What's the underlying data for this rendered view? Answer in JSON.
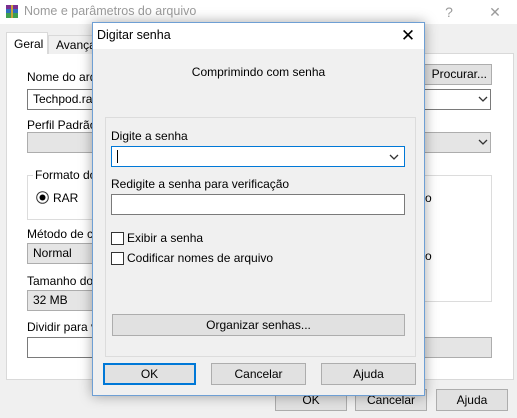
{
  "background_window": {
    "title": "Nome e parâmetros do arquivo",
    "controls": {
      "help": "?",
      "close": "✕"
    },
    "tabs": [
      "Geral",
      "Avança"
    ],
    "archive_name_label": "Nome do arqu",
    "archive_name_value": "Techpod.rar",
    "browse_button": "Procurar...",
    "profile_label": "Perfil Padrão",
    "format_group_label": "Formato do",
    "format_rar": "RAR",
    "method_label": "Método de co",
    "method_value": "Normal",
    "dict_size_label": "Tamanho do d",
    "dict_size_value": "32 MB",
    "split_label": "Dividir para vo",
    "partial_right_1": "o",
    "partial_right_2": "o",
    "buttons": {
      "ok": "OK",
      "cancel": "Cancelar",
      "help": "Ajuda"
    }
  },
  "dialog": {
    "title": "Digitar senha",
    "close_glyph": "✕",
    "heading": "Comprimindo com senha",
    "password_label": "Digite a senha",
    "password_value": "",
    "verify_label": "Redigite a senha para verificação",
    "verify_value": "",
    "show_password_label": "Exibir a senha",
    "show_password_checked": false,
    "encrypt_names_label": "Codificar nomes de arquivo",
    "encrypt_names_checked": false,
    "organize_button": "Organizar senhas...",
    "buttons": {
      "ok": "OK",
      "cancel": "Cancelar",
      "help": "Ajuda"
    }
  },
  "icons": {
    "app": "winrar-archive-icon",
    "dropdown": "chevron-down-icon",
    "close": "close-icon"
  },
  "colors": {
    "accent": "#0078d7",
    "window_bg": "#f0f0f0",
    "disabled_text": "#9b9b9b"
  }
}
